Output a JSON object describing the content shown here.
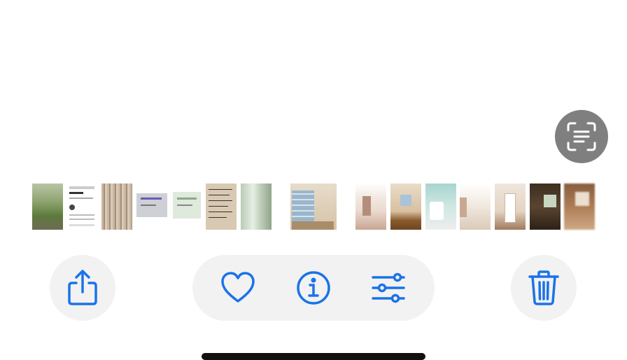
{
  "colors": {
    "accent": "#1a73e8",
    "button_bg": "#f2f2f3",
    "live_text_bg": "#7f7f7f"
  },
  "live_text_button": {
    "icon": "live-text-scan-icon"
  },
  "toolbar": {
    "share": {
      "icon": "share-icon"
    },
    "favorite": {
      "icon": "heart-icon"
    },
    "info": {
      "icon": "info-icon"
    },
    "adjust": {
      "icon": "sliders-icon"
    },
    "delete": {
      "icon": "trash-icon"
    }
  },
  "thumbnails": [
    {
      "name": "thumb-yard-photo",
      "selected": false
    },
    {
      "name": "thumb-document-screenshot",
      "selected": false
    },
    {
      "name": "thumb-wood-panel",
      "selected": false
    },
    {
      "name": "thumb-id-card",
      "selected": false
    },
    {
      "name": "thumb-certificate",
      "selected": false
    },
    {
      "name": "thumb-handwritten-note",
      "selected": false
    },
    {
      "name": "thumb-window-blinds",
      "selected": false
    },
    {
      "name": "thumb-room-window",
      "selected": true
    },
    {
      "name": "thumb-empty-room",
      "selected": false
    },
    {
      "name": "thumb-room-wood-floor",
      "selected": false
    },
    {
      "name": "thumb-bathroom",
      "selected": false
    },
    {
      "name": "thumb-hallway",
      "selected": false
    },
    {
      "name": "thumb-doorway",
      "selected": false
    },
    {
      "name": "thumb-dark-room",
      "selected": false
    },
    {
      "name": "thumb-brown-room",
      "selected": false
    }
  ]
}
